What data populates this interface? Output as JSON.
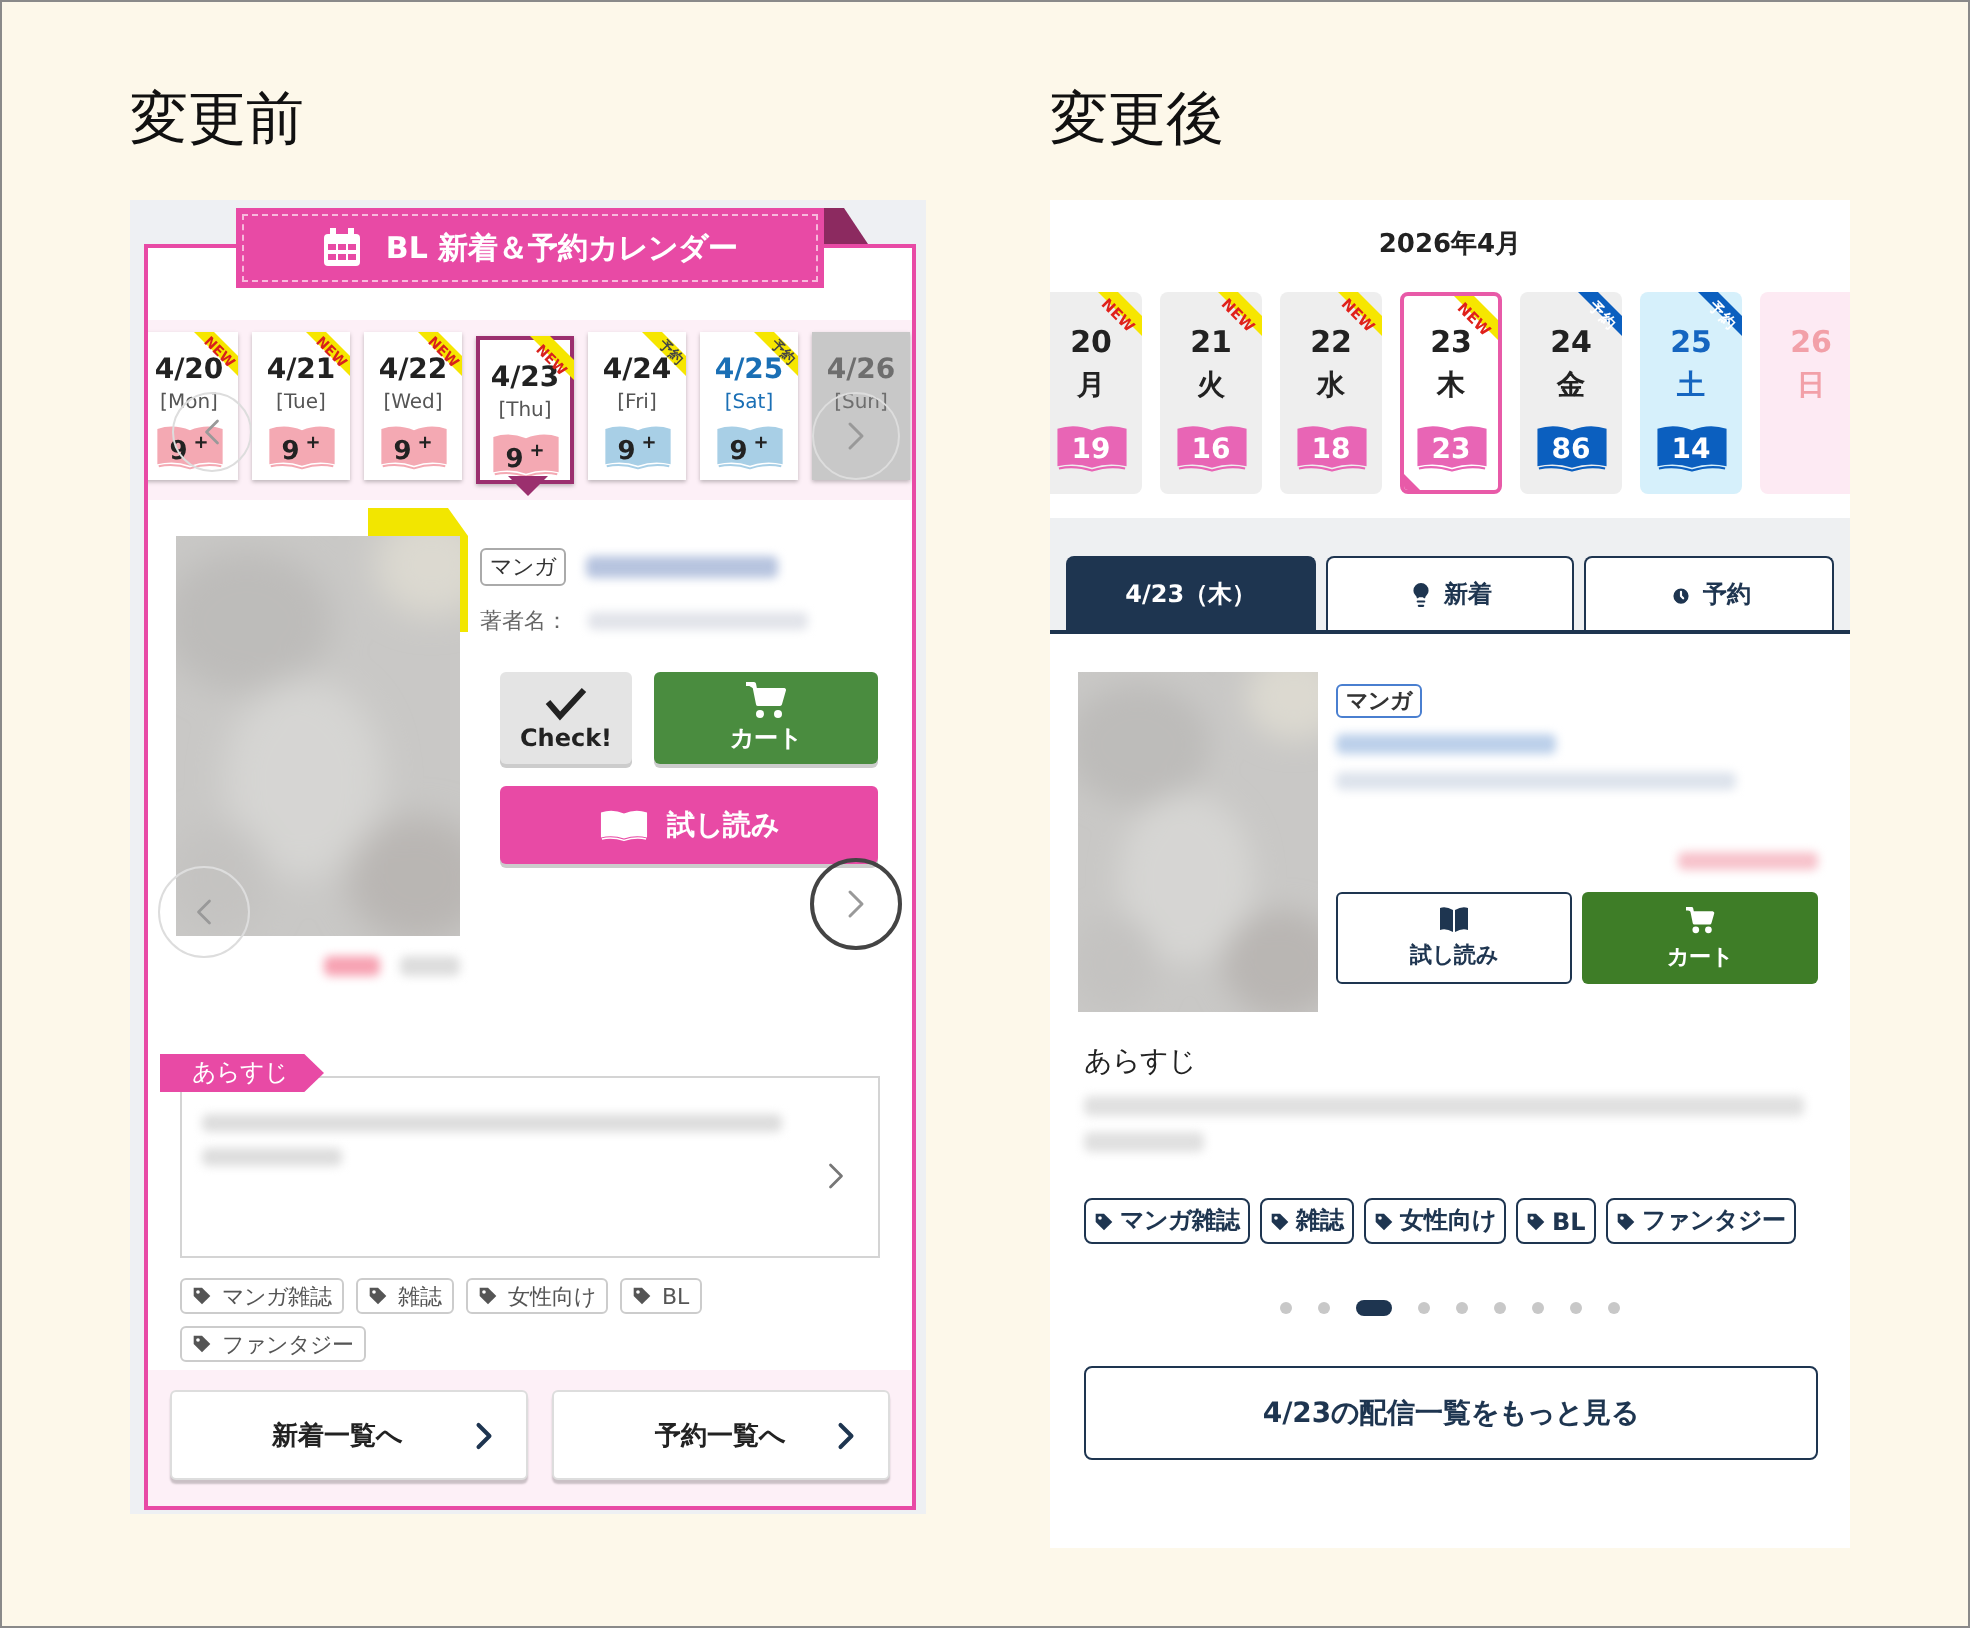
{
  "before": {
    "heading": "変更前",
    "banner_title": "BL 新着＆予約カレンダー",
    "days": [
      {
        "date": "4/20",
        "weekday": "[Mon]",
        "count": "9",
        "plus": "+",
        "ribbon": "NEW",
        "kind": "new",
        "color": "#222222",
        "selected": false
      },
      {
        "date": "4/21",
        "weekday": "[Tue]",
        "count": "9",
        "plus": "+",
        "ribbon": "NEW",
        "kind": "new",
        "color": "#222222",
        "selected": false
      },
      {
        "date": "4/22",
        "weekday": "[Wed]",
        "count": "9",
        "plus": "+",
        "ribbon": "NEW",
        "kind": "new",
        "color": "#222222",
        "selected": false
      },
      {
        "date": "4/23",
        "weekday": "[Thu]",
        "count": "9",
        "plus": "+",
        "ribbon": "NEW",
        "kind": "new",
        "color": "#222222",
        "selected": true
      },
      {
        "date": "4/24",
        "weekday": "[Fri]",
        "count": "9",
        "plus": "+",
        "ribbon": "予約",
        "kind": "reserve",
        "color": "#222222",
        "selected": false
      },
      {
        "date": "4/25",
        "weekday": "[Sat]",
        "count": "9",
        "plus": "+",
        "ribbon": "予約",
        "kind": "reserve",
        "color": "#1a6fb5",
        "selected": false
      },
      {
        "date": "4/26",
        "weekday": "[Sun]",
        "kind": "off",
        "color": "#6e6e6e",
        "selected": false
      }
    ],
    "product": {
      "genre": "マンガ",
      "author_label": "著者名：",
      "check_label": "Check!",
      "cart_label": "カート",
      "preview_label": "試し読み"
    },
    "synopsis_label": "あらすじ",
    "tags": [
      "マンガ雑誌",
      "雑誌",
      "女性向け",
      "BL",
      "ファンタジー"
    ],
    "footer_buttons": [
      "新着一覧へ",
      "予約一覧へ"
    ]
  },
  "after": {
    "heading": "変更後",
    "month": "2026年4月",
    "days": [
      {
        "day": "20",
        "weekday": "月",
        "count": "19",
        "ribbon": {
          "label": "NEW",
          "kind": "new"
        },
        "kind": "weekday",
        "selected": false
      },
      {
        "day": "21",
        "weekday": "火",
        "count": "16",
        "ribbon": {
          "label": "NEW",
          "kind": "new"
        },
        "kind": "weekday",
        "selected": false
      },
      {
        "day": "22",
        "weekday": "水",
        "count": "18",
        "ribbon": {
          "label": "NEW",
          "kind": "new"
        },
        "kind": "weekday",
        "selected": false
      },
      {
        "day": "23",
        "weekday": "木",
        "count": "23",
        "ribbon": {
          "label": "NEW",
          "kind": "new"
        },
        "kind": "weekday",
        "selected": true
      },
      {
        "day": "24",
        "weekday": "金",
        "count": "86",
        "ribbon": {
          "label": "予約",
          "kind": "reserve"
        },
        "kind": "weekday",
        "selected": false
      },
      {
        "day": "25",
        "weekday": "土",
        "count": "14",
        "ribbon": {
          "label": "予約",
          "kind": "reserve"
        },
        "kind": "saturday",
        "selected": false
      },
      {
        "day": "26",
        "weekday": "日",
        "kind": "sunday",
        "selected": false
      }
    ],
    "tabs": [
      {
        "label": "4/23（木）",
        "kind": "date",
        "selected": true
      },
      {
        "label": "新着",
        "kind": "new",
        "selected": false
      },
      {
        "label": "予約",
        "kind": "reserve",
        "selected": false
      }
    ],
    "product": {
      "genre": "マンガ",
      "preview_label": "試し読み",
      "cart_label": "カート"
    },
    "synopsis_label": "あらすじ",
    "tags": [
      "マンガ雑誌",
      "雑誌",
      "女性向け",
      "BL",
      "ファンタジー"
    ],
    "pager": [
      {
        "selected": false
      },
      {
        "selected": false
      },
      {
        "selected": true
      },
      {
        "selected": false
      },
      {
        "selected": false
      },
      {
        "selected": false
      },
      {
        "selected": false
      },
      {
        "selected": false
      },
      {
        "selected": false
      }
    ],
    "more_button": "4/23の配信一覧をもっと見る"
  }
}
